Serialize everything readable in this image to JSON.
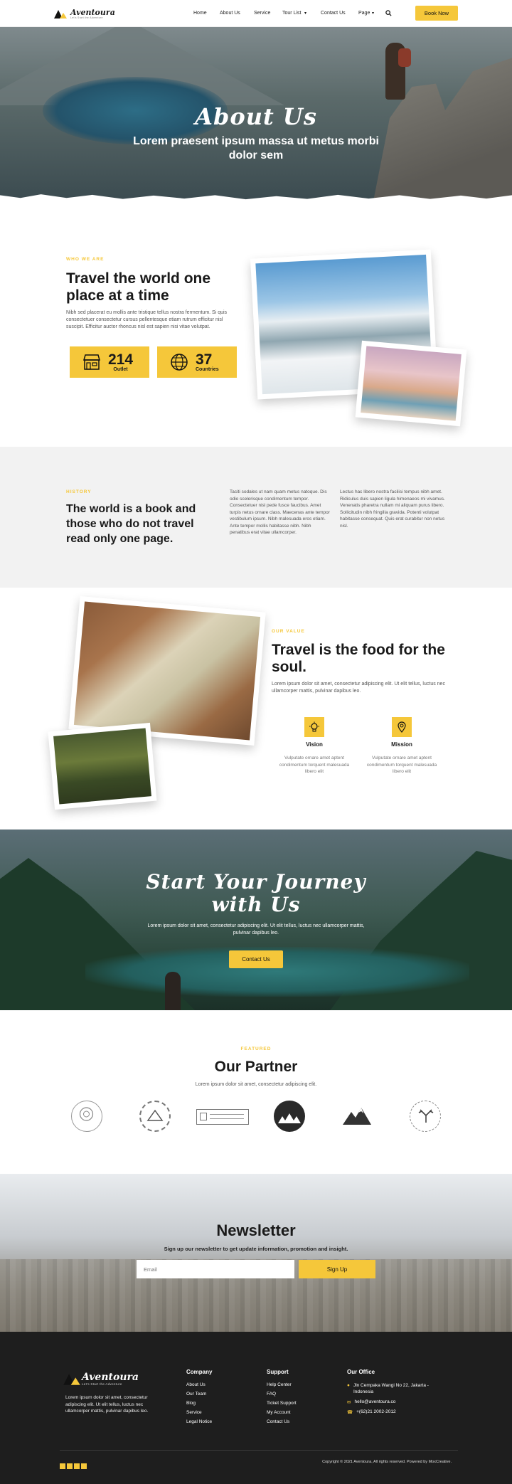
{
  "header": {
    "logo_text": "Aventoura",
    "logo_tagline": "Let's Start the Adventure",
    "nav": [
      "Home",
      "About Us",
      "Service",
      "Tour List",
      "Contact Us",
      "Page"
    ],
    "book_button": "Book Now"
  },
  "hero": {
    "title": "About Us",
    "subtitle": "Lorem praesent ipsum massa ut metus morbi dolor sem"
  },
  "who": {
    "eyebrow": "WHO WE ARE",
    "title": "Travel the world one place at a time",
    "body": "Nibh sed placerat eu mollis ante tristique tellus nostra fermentum. Si quis consectetuer consectetur cursus pellentesque etiam rutrum efficitur nisl suscipit. Efficitur auctor rhoncus nisl est sapien nisi vitae volutpat.",
    "stats": [
      {
        "number": "214",
        "label": "Outlet",
        "icon": "store-icon"
      },
      {
        "number": "37",
        "label": "Countries",
        "icon": "globe-icon"
      }
    ]
  },
  "history": {
    "eyebrow": "HISTORY",
    "title": "The world is a book and those who do not travel read only one page.",
    "col1": "Taciti sodales ut nam quam metus natoque. Dis odio scelerisque condimentum tempor. Consectetuer nisl pede fusce faucibus. Amet turpis netus ornare class. Maecenas ante tempor vestibulum ipsum. Nibh malesuada eros etiam. Ante tempor mollis habitasse nibh. Nibh penatibus erat vitae ullamcorper.",
    "col2": "Lectus hac libero nostra facilisi tempus nibh amet. Ridiculus duis sapien ligula himenaeos mi vivamus. Venenatis pharetra nullam mi aliquam purus libero. Sollicitudin nibh fringilla gravida. Potenti volutpat habitasse consequat. Quis erat curabitur non netus nisl."
  },
  "value": {
    "eyebrow": "OUR VALUE",
    "title": "Travel is the food for the soul.",
    "body": "Lorem ipsum dolor sit amet, consectetur adipiscing elit. Ut elit tellus, luctus nec ullamcorper mattis, pulvinar dapibus leo.",
    "items": [
      {
        "title": "Vision",
        "text": "Vulputate ornare amet aptent condimentum torquent malesuada libero elit",
        "icon": "lightbulb-icon"
      },
      {
        "title": "Mission",
        "text": "Vulputate ornare amet aptent condimentum torquent malesuada libero elit",
        "icon": "map-pin-icon"
      }
    ]
  },
  "cta": {
    "title": "Start Your Journey with Us",
    "body": "Lorem ipsum dolor sit amet, consectetur adipiscing elit. Ut elit tellus, luctus nec ullamcorper mattis, pulvinar dapibus leo.",
    "button": "Contact Us"
  },
  "partner": {
    "eyebrow": "FEATURED",
    "title": "Our Partner",
    "body": "Lorem ipsum dolor sit amet, consectetur adipiscing elit."
  },
  "newsletter": {
    "title": "Newsletter",
    "subtitle": "Sign up our newsletter to get update information, promotion and insight.",
    "placeholder": "Email",
    "button": "Sign Up"
  },
  "footer": {
    "about": "Lorem ipsum dolor sit amet, consectetur adipiscing elit. Ut elit tellus, luctus nec ullamcorper mattis, pulvinar dapibus leo.",
    "company_title": "Company",
    "company_links": [
      "About Us",
      "Our Team",
      "Blog",
      "Service",
      "Legal Notice"
    ],
    "support_title": "Support",
    "support_links": [
      "Help Center",
      "FAQ",
      "Ticket Support",
      "My Account",
      "Contact Us"
    ],
    "office_title": "Our Office",
    "office": [
      "Jln Cempaka Wangi No 22, Jakarta - Indonesia",
      "hello@aventoura.co",
      "+(62)21 2002-2012"
    ],
    "copyright": "Copyright © 2021 Aventoura, All rights reserved. Powered by MoxCreative."
  },
  "colors": {
    "accent": "#f5c73a",
    "dark": "#1e1e1e"
  }
}
